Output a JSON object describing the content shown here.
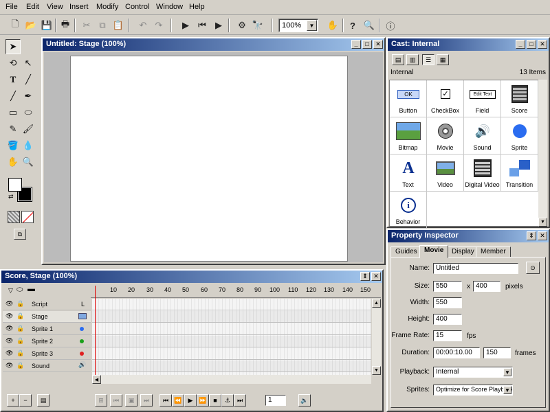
{
  "menu": [
    "File",
    "Edit",
    "View",
    "Insert",
    "Modify",
    "Control",
    "Window",
    "Help"
  ],
  "toolbar": {
    "zoom": "100%",
    "icons": [
      "new-icon",
      "open-icon",
      "save-icon",
      "print-icon",
      "cut-icon",
      "copy-icon",
      "paste-icon",
      "undo-icon",
      "redo-icon",
      "play-icon",
      "rewind-icon",
      "stop-icon",
      "binoculars-icon",
      "find-icon",
      "hand-icon",
      "help-icon",
      "zoom-icon",
      "context-help-icon"
    ]
  },
  "stage": {
    "title": "Untitled: Stage (100%)"
  },
  "cast": {
    "title": "Cast: Internal",
    "header_left": "Internal",
    "header_right": "13 Items",
    "items": [
      {
        "label": "Button"
      },
      {
        "label": "CheckBox"
      },
      {
        "label": "Field"
      },
      {
        "label": "Score"
      },
      {
        "label": "Bitmap"
      },
      {
        "label": "Movie"
      },
      {
        "label": "Sound"
      },
      {
        "label": "Sprite"
      },
      {
        "label": "Text"
      },
      {
        "label": "Video"
      },
      {
        "label": "Digital Video"
      },
      {
        "label": "Transition"
      },
      {
        "label": "Behavior"
      }
    ],
    "button_thumb": "OK",
    "field_thumb": "Edit Text",
    "text_thumb": "A",
    "behavior_thumb": "i"
  },
  "inspector": {
    "title": "Property Inspector",
    "tabs": [
      "Guides",
      "Movie",
      "Display",
      "Member"
    ],
    "selected_tab": "Movie",
    "name_label": "Name:",
    "name": "Untitled",
    "size_label": "Size:",
    "size_w": "550",
    "size_x": "x",
    "size_h": "400",
    "size_unit": "pixels",
    "width_label": "Width:",
    "width": "550",
    "height_label": "Height:",
    "height": "400",
    "framerate_label": "Frame Rate:",
    "framerate": "15",
    "fps": "fps",
    "duration_label": "Duration:",
    "duration": "00:00:10.00",
    "frames": "150",
    "frames_unit": "frames",
    "playback_label": "Playback:",
    "playback": "Internal",
    "sprites_label": "Sprites:",
    "sprites": "Optimize for Score Playback"
  },
  "score": {
    "title": "Score, Stage (100%)",
    "ticks": [
      "10",
      "20",
      "30",
      "40",
      "50",
      "60",
      "70",
      "80",
      "90",
      "100",
      "110",
      "120",
      "130",
      "140",
      "150"
    ],
    "channels": [
      {
        "name": "Script",
        "tag": "L"
      },
      {
        "name": "Stage",
        "tag": ""
      },
      {
        "name": "Sprite 1",
        "tag": ""
      },
      {
        "name": "Sprite 2",
        "tag": ""
      },
      {
        "name": "Sprite 3",
        "tag": ""
      },
      {
        "name": "Sound",
        "tag": ""
      }
    ],
    "dot_colors": {
      "sprite1": "#2a6cf0",
      "sprite2": "#1aa01a",
      "sprite3": "#e02020"
    },
    "frame_value": "1"
  }
}
